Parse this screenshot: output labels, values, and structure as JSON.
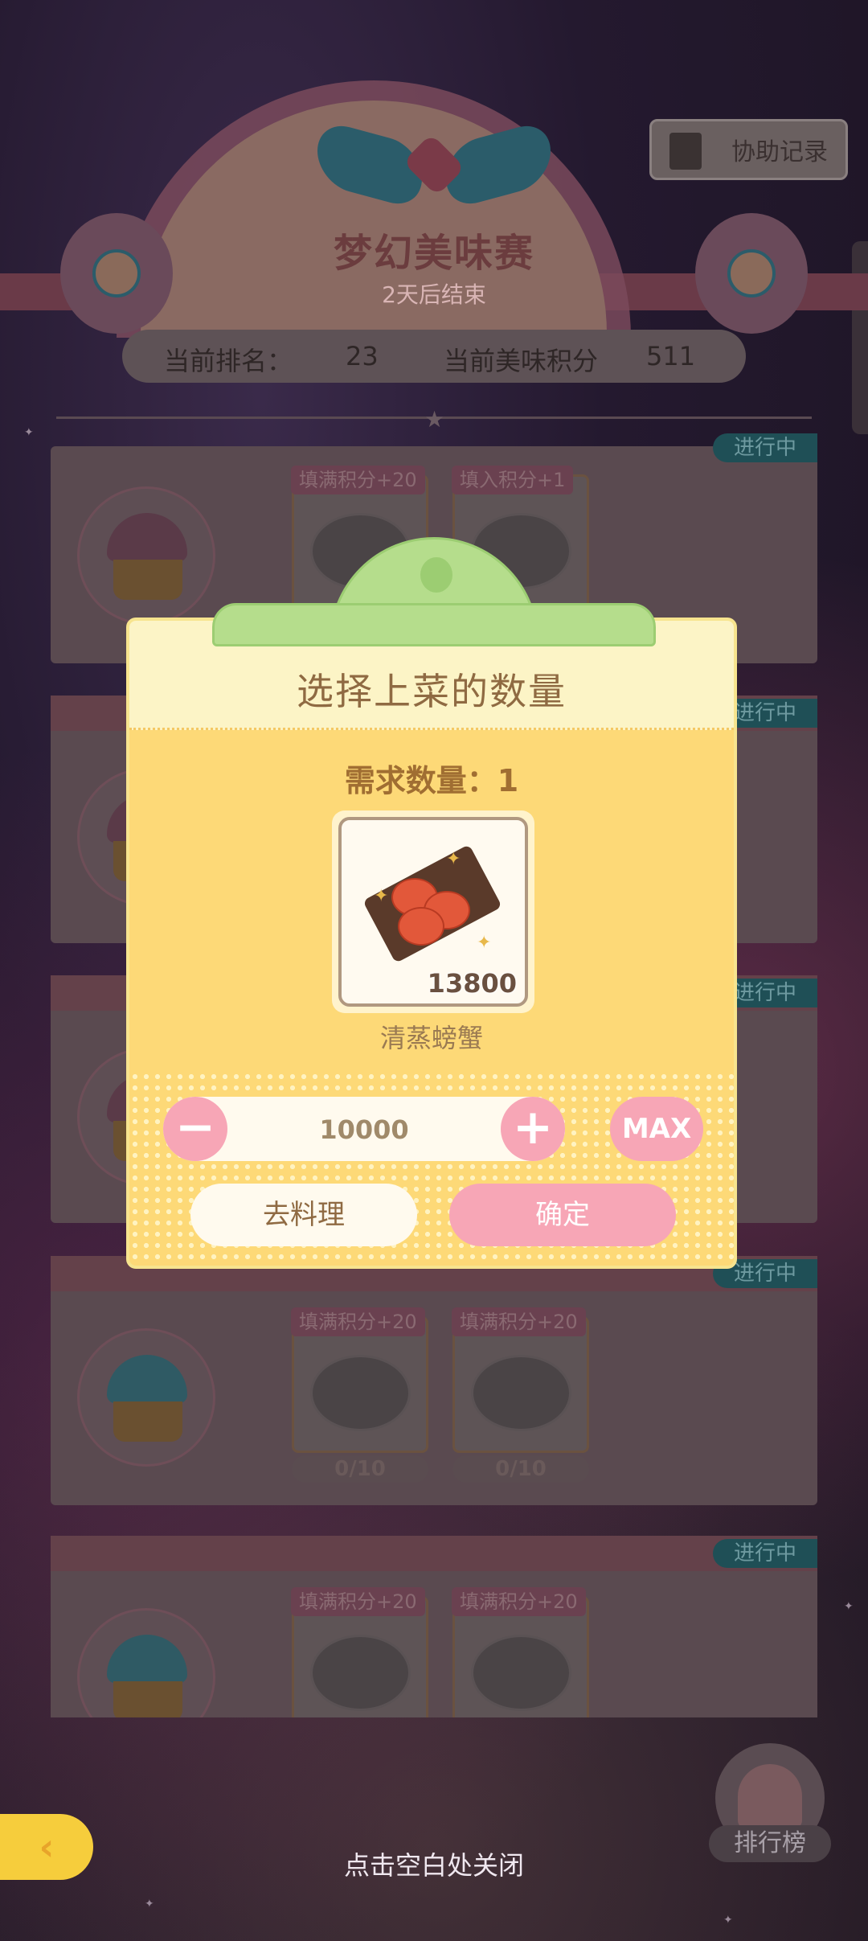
{
  "header": {
    "assist_record_label": "协助记录",
    "event_title": "梦幻美味赛",
    "event_subtitle": "2天后结束",
    "rank_label": "当前排名：",
    "rank_value": "23",
    "score_label": "当前美味积分",
    "score_value": "511"
  },
  "cards": [
    {
      "status": "进行中",
      "slots": [
        {
          "tag": "填满积分+20"
        },
        {
          "tag": "填入积分+1"
        }
      ]
    },
    {
      "status": "进行中"
    },
    {
      "status": "进行中"
    },
    {
      "status": "进行中",
      "slots": [
        {
          "tag": "填满积分+20",
          "count": "0/10"
        },
        {
          "tag": "填满积分+20",
          "count": "0/10"
        }
      ]
    },
    {
      "status": "进行中",
      "slots": [
        {
          "tag": "填满积分+20"
        },
        {
          "tag": "填满积分+20"
        }
      ]
    }
  ],
  "modal": {
    "title": "选择上菜的数量",
    "need_label": "需求数量：1",
    "item": {
      "name": "清蒸螃蟹",
      "owned": "13800"
    },
    "quantity_value": "10000",
    "minus_symbol": "−",
    "plus_symbol": "+",
    "max_label": "MAX",
    "cook_button": "去料理",
    "confirm_button": "确定"
  },
  "footer": {
    "close_hint": "点击空白处关闭",
    "back_icon": "back-arrow-icon",
    "leaderboard_label": "排行榜"
  },
  "colors": {
    "modal_bg": "#fdd977",
    "modal_head": "#fcf4c6",
    "accent_pink": "#f7a6b6",
    "tab_green": "#b5dd8c"
  }
}
